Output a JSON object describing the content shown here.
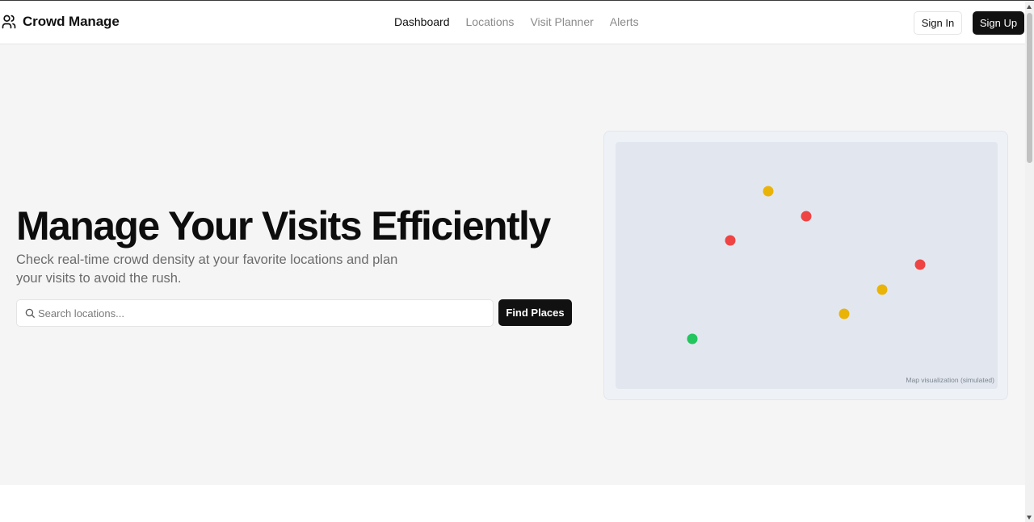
{
  "header": {
    "brand_name": "Crowd Manage",
    "brand_icon": "users-icon",
    "nav": [
      {
        "label": "Dashboard",
        "active": true
      },
      {
        "label": "Locations",
        "active": false
      },
      {
        "label": "Visit Planner",
        "active": false
      },
      {
        "label": "Alerts",
        "active": false
      }
    ],
    "sign_in_label": "Sign In",
    "sign_up_label": "Sign Up"
  },
  "hero": {
    "title": "Manage Your Visits Efficiently",
    "subtitle": "Check real-time crowd density at your favorite locations and plan your visits to avoid the rush.",
    "search": {
      "placeholder": "Search locations...",
      "value": "",
      "icon": "search-icon"
    },
    "find_button_label": "Find Places"
  },
  "map": {
    "caption": "Map visualization (simulated)",
    "colors": {
      "low": "#22c55e",
      "medium": "#eab308",
      "high": "#ef4444",
      "background": "#e2e7ef"
    },
    "markers": [
      {
        "density": "medium"
      },
      {
        "density": "high"
      },
      {
        "density": "high"
      },
      {
        "density": "high"
      },
      {
        "density": "medium"
      },
      {
        "density": "medium"
      },
      {
        "density": "low"
      }
    ]
  }
}
